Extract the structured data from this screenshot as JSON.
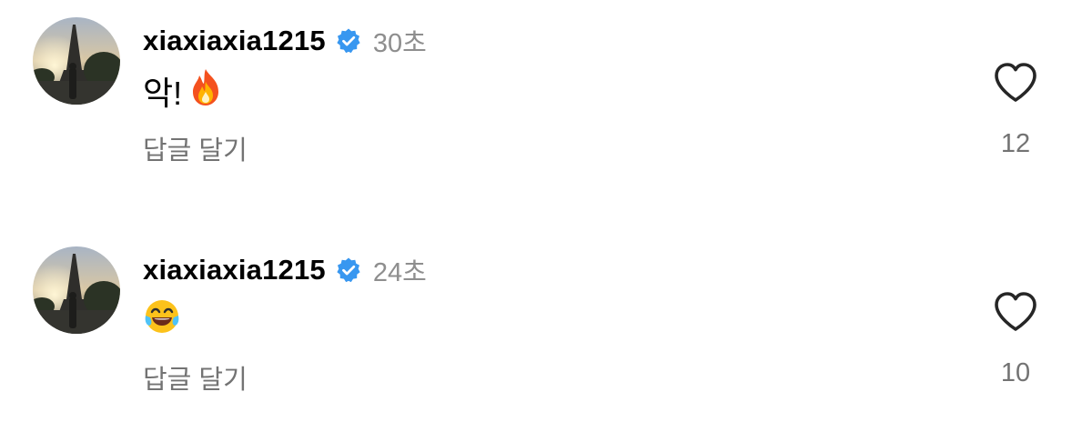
{
  "comments": [
    {
      "username": "xiaxiaxia1215",
      "time": "30초",
      "text": "악!",
      "emoji": "fire-emoji",
      "reply_label": "답글 달기",
      "like_count": "12"
    },
    {
      "username": "xiaxiaxia1215",
      "time": "24초",
      "text": "",
      "emoji": "tears-of-joy-emoji",
      "reply_label": "답글 달기",
      "like_count": "10"
    }
  ],
  "colors": {
    "verified_badge": "#3897f0",
    "secondary_text": "#737373",
    "timestamp": "#8e8e8e"
  }
}
